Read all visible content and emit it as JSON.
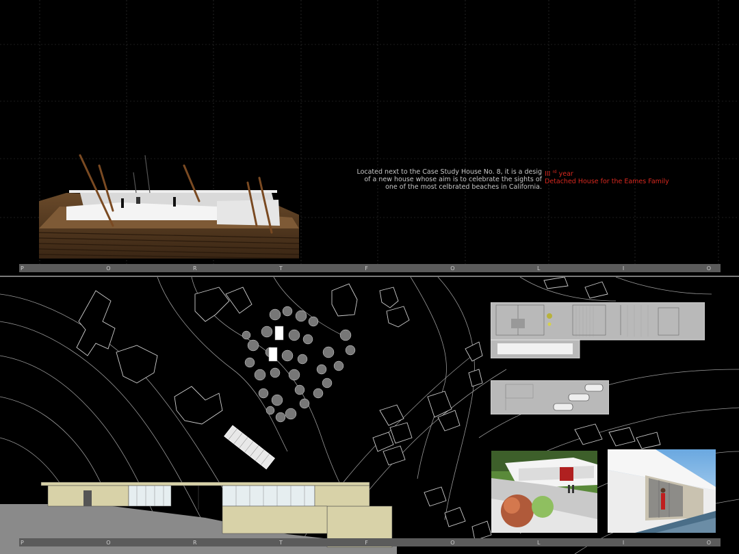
{
  "description": {
    "lines": [
      "Located next to the Case Study House No. 8, it is a desig",
      "of a new house whose aim is to celebrate the sights of",
      "one of the most celbrated beaches in California."
    ]
  },
  "project_tag": {
    "year_prefix": "III",
    "year_sup": "rd",
    "year_suffix": "year",
    "title": "Detached House for the Eames Family"
  },
  "banner_top": {
    "letters": [
      "P",
      "O",
      "R",
      "T",
      "F",
      "O",
      "L",
      "I",
      "O"
    ]
  },
  "banner_bottom": {
    "letters": [
      "P",
      "O",
      "R",
      "T",
      "F",
      "O",
      "L",
      "I",
      "O"
    ]
  },
  "colors": {
    "accent": "#d8281f",
    "banner": "#5b5b5b",
    "background": "#000000"
  }
}
